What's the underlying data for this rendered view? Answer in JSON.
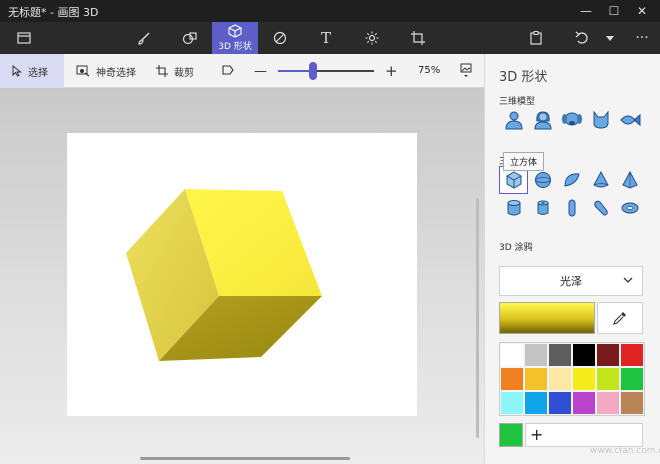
{
  "window": {
    "title": "无标题* - 画图 3D",
    "min": "—",
    "max": "☐",
    "close": "✕"
  },
  "mainbar": {
    "active_label": "3D 形状",
    "text_glyph": "T"
  },
  "subbar": {
    "select_label": "选择",
    "magic_select_label": "神奇选择",
    "crop_label": "裁剪",
    "zoom_out": "—",
    "zoom_in": "+",
    "zoom_value": "75%",
    "zoom_fraction": 0.36
  },
  "panel": {
    "title": "3D 形状",
    "models_label": "三维模型",
    "objects_label": "三",
    "tooltip": "立方体",
    "doodle_label": "3D 涂鸦",
    "material": "光泽",
    "add_label": "+",
    "selected_object": "cube-icon",
    "palette": [
      "#ffffff",
      "#c4c4c4",
      "#5e5e5e",
      "#000000",
      "#7a1b1b",
      "#e02323",
      "#f08020",
      "#f2c12c",
      "#fde8a6",
      "#f6ec1b",
      "#c2e61a",
      "#1ec33f",
      "#8ef5f7",
      "#10a4e8",
      "#2f4ed3",
      "#b944c9",
      "#f3a9c2",
      "#b98457"
    ],
    "current_color": "#1ec33f"
  },
  "watermark": "www.cfan.com.cn"
}
